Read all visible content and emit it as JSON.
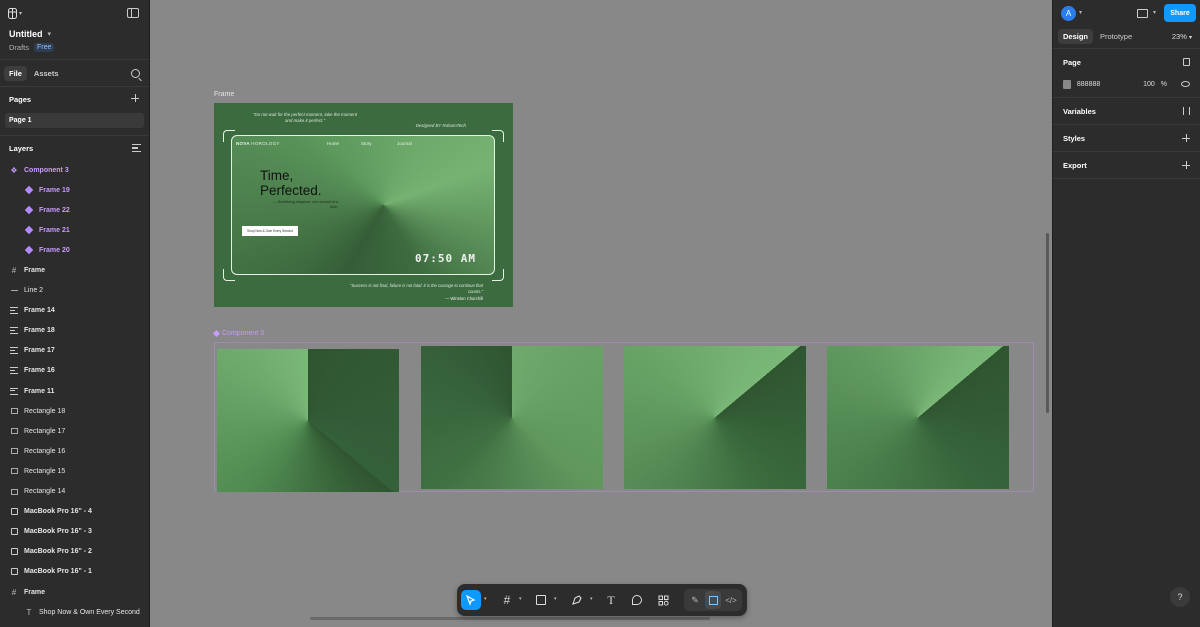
{
  "file": {
    "title": "Untitled",
    "location": "Drafts",
    "plan_badge": "Free"
  },
  "left_tabs": [
    "File",
    "Assets"
  ],
  "pages": {
    "heading": "Pages",
    "items": [
      "Page 1"
    ]
  },
  "layers": {
    "heading": "Layers",
    "items": [
      {
        "label": "Component 3",
        "kind": "component"
      },
      {
        "label": "Frame 19",
        "kind": "variant"
      },
      {
        "label": "Frame 22",
        "kind": "variant"
      },
      {
        "label": "Frame 21",
        "kind": "variant"
      },
      {
        "label": "Frame 20",
        "kind": "variant"
      },
      {
        "label": "Frame",
        "kind": "frame"
      },
      {
        "label": "Line 2",
        "kind": "line"
      },
      {
        "label": "Frame 14",
        "kind": "autolayout"
      },
      {
        "label": "Frame 18",
        "kind": "autolayout"
      },
      {
        "label": "Frame 17",
        "kind": "autolayout"
      },
      {
        "label": "Frame 16",
        "kind": "autolayout"
      },
      {
        "label": "Frame 11",
        "kind": "autolayout"
      },
      {
        "label": "Rectangle 18",
        "kind": "rect"
      },
      {
        "label": "Rectangle 17",
        "kind": "rect"
      },
      {
        "label": "Rectangle 16",
        "kind": "rect"
      },
      {
        "label": "Rectangle 15",
        "kind": "rect"
      },
      {
        "label": "Rectangle 14",
        "kind": "rect"
      },
      {
        "label": "MacBook Pro 16\" - 4",
        "kind": "device"
      },
      {
        "label": "MacBook Pro 16\" - 3",
        "kind": "device"
      },
      {
        "label": "MacBook Pro 16\" - 2",
        "kind": "device"
      },
      {
        "label": "MacBook Pro 16\" - 1",
        "kind": "device"
      },
      {
        "label": "Frame",
        "kind": "frame"
      },
      {
        "label": "Shop Now & Own Every Second",
        "kind": "text"
      }
    ]
  },
  "right_panel": {
    "avatar_initial": "A",
    "share_label": "Share",
    "tabs": [
      "Design",
      "Prototype"
    ],
    "zoom": "23%",
    "page_section": {
      "title": "Page",
      "color_hex": "888888",
      "opacity": "100",
      "opacity_unit": "%"
    },
    "sections": [
      "Variables",
      "Styles",
      "Export"
    ],
    "help": "?"
  },
  "canvas": {
    "frame_label": "Frame",
    "component_label": "Component 3",
    "hero": {
      "quote_top": "\"Do not wait for the perfect moment, take the moment and make it perfect.\"",
      "designed_by": "Designed BY RahamTech",
      "brand_a": "NOVA",
      "brand_b": "HOROLOGY",
      "nav": [
        "Home",
        "Story",
        "Journal"
      ],
      "headline_1": "Time,",
      "headline_2": "Perfected.",
      "tagline": "— Redefining elegance, one second at a time.",
      "cta": "Shop Now & Own Every Second",
      "clock": "07:50 AM",
      "quote_bottom": "\"Success is not final, failure is not fatal: it is the courage to continue that counts.\"",
      "quote_author": "— Winston Churchill"
    }
  },
  "toolbar": {
    "tools": [
      "move-tool",
      "frame-tool",
      "shape-tool",
      "pen-tool",
      "text-tool",
      "comment-tool",
      "actions-tool"
    ],
    "modes": [
      "draw-mode",
      "design-mode",
      "dev-mode"
    ]
  },
  "colors": {
    "accent": "#0d99ff",
    "component": "#c99bff",
    "canvas": "#888888",
    "panel": "#2c2c2c"
  }
}
